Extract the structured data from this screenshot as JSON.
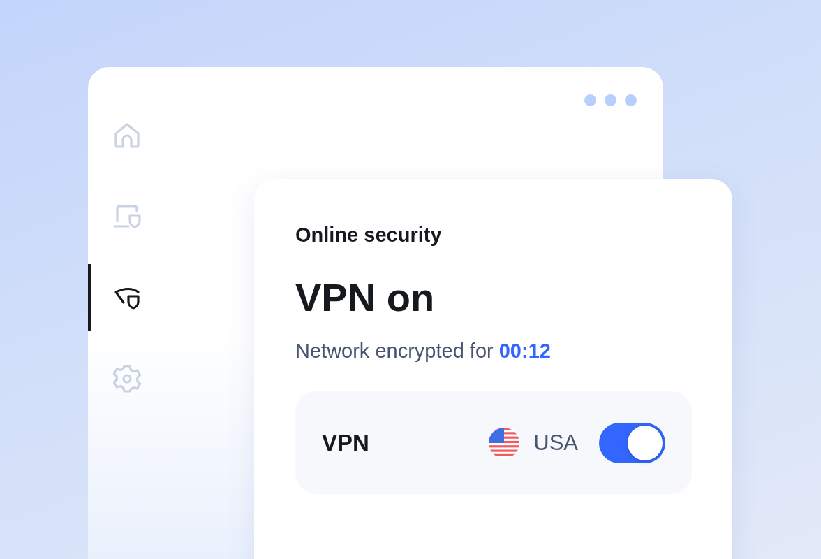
{
  "sidebar": {
    "items": [
      {
        "kind": "home",
        "selected": false
      },
      {
        "kind": "device",
        "selected": false
      },
      {
        "kind": "vpn",
        "selected": true
      },
      {
        "kind": "settings",
        "selected": false
      }
    ]
  },
  "card": {
    "title": "Online security",
    "heading": "VPN on",
    "status": "Network encrypted for ",
    "timer": "00:12",
    "vpn_row": {
      "label": "VPN",
      "country": "USA",
      "on": true
    }
  }
}
